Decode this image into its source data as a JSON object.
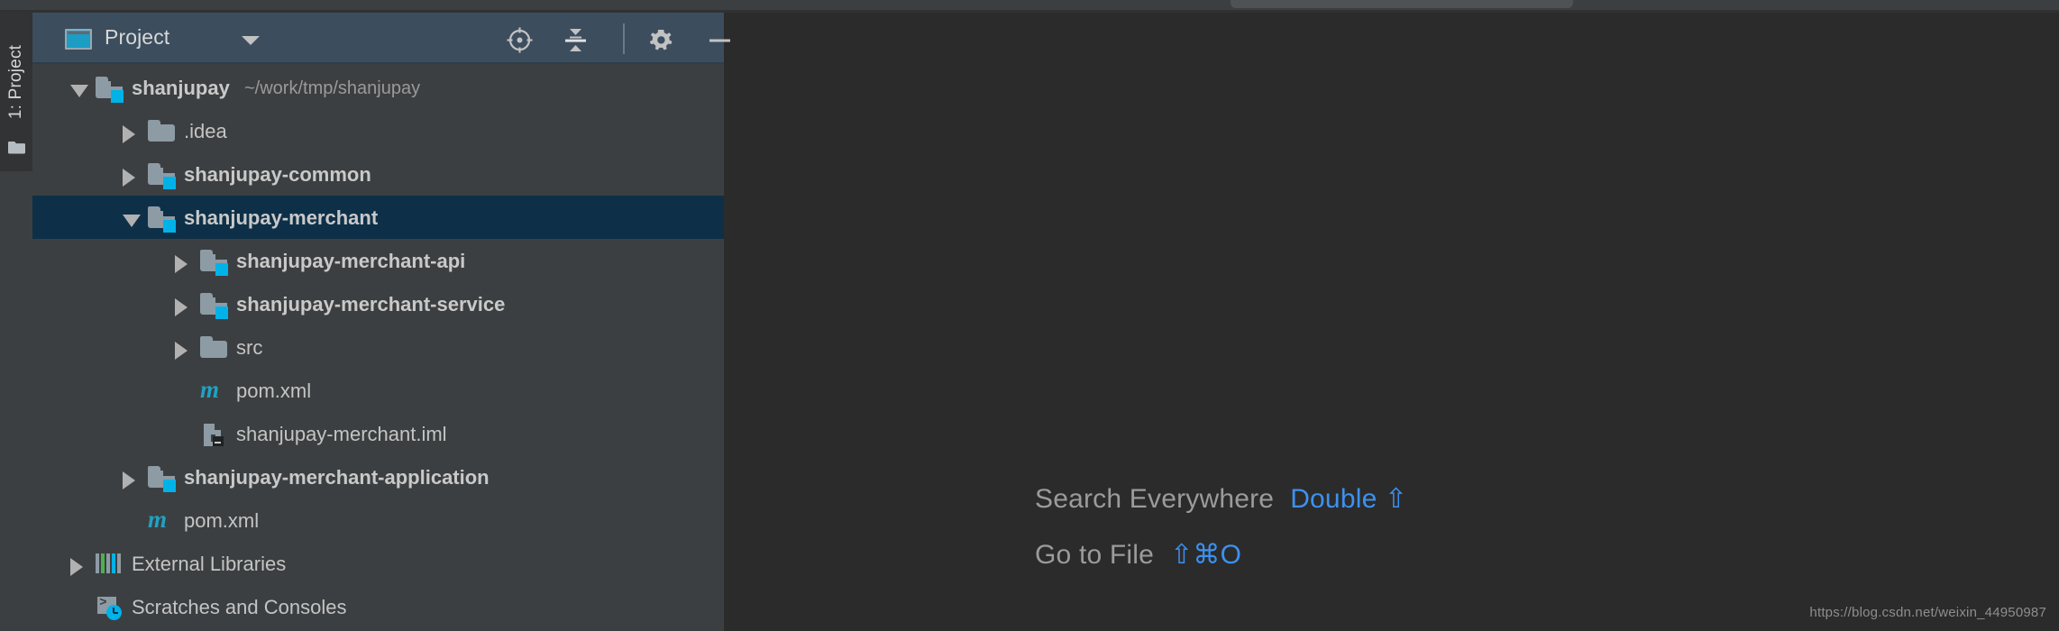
{
  "window": {
    "background_color": "#2b2b2b",
    "panel_color": "#3c3f41",
    "header_color": "#3c4d5e",
    "selection_color": "#0d3048",
    "accent_color": "#00b2e8",
    "link_color": "#3d91f0"
  },
  "tool_window_tab": {
    "label": "1: Project",
    "icon": "folder-icon"
  },
  "panel": {
    "title": "Project",
    "title_icon": "project-view-icon",
    "dropdown_icon": "chevron-down-icon",
    "buttons": [
      {
        "name": "locate-button",
        "icon": "crosshair-target-icon",
        "tooltip": "Select Opened File"
      },
      {
        "name": "collapse-all-button",
        "icon": "collapse-all-icon",
        "tooltip": "Collapse All"
      },
      {
        "name": "settings-button",
        "icon": "gear-icon",
        "tooltip": "Settings"
      },
      {
        "name": "hide-button",
        "icon": "minimize-icon",
        "tooltip": "Hide"
      }
    ]
  },
  "tree": {
    "rows": [
      {
        "label": "shanjupay",
        "path": "~/work/tmp/shanjupay",
        "icon": "module-folder-icon",
        "twisty": "open",
        "depth": 0,
        "bold": true,
        "selected": false
      },
      {
        "label": ".idea",
        "path": "",
        "icon": "folder-icon",
        "twisty": "closed",
        "depth": 1,
        "bold": false,
        "selected": false
      },
      {
        "label": "shanjupay-common",
        "path": "",
        "icon": "module-folder-icon",
        "twisty": "closed",
        "depth": 1,
        "bold": true,
        "selected": false
      },
      {
        "label": "shanjupay-merchant",
        "path": "",
        "icon": "module-folder-icon",
        "twisty": "open",
        "depth": 1,
        "bold": true,
        "selected": true
      },
      {
        "label": "shanjupay-merchant-api",
        "path": "",
        "icon": "module-folder-icon",
        "twisty": "closed",
        "depth": 2,
        "bold": true,
        "selected": false
      },
      {
        "label": "shanjupay-merchant-service",
        "path": "",
        "icon": "module-folder-icon",
        "twisty": "closed",
        "depth": 2,
        "bold": true,
        "selected": false
      },
      {
        "label": "src",
        "path": "",
        "icon": "folder-icon",
        "twisty": "closed",
        "depth": 2,
        "bold": false,
        "selected": false
      },
      {
        "label": "pom.xml",
        "path": "",
        "icon": "maven-icon",
        "twisty": "none",
        "depth": 2,
        "bold": false,
        "selected": false
      },
      {
        "label": "shanjupay-merchant.iml",
        "path": "",
        "icon": "iml-file-icon",
        "twisty": "none",
        "depth": 2,
        "bold": false,
        "selected": false
      },
      {
        "label": "shanjupay-merchant-application",
        "path": "",
        "icon": "module-folder-icon",
        "twisty": "closed",
        "depth": 1,
        "bold": true,
        "selected": false
      },
      {
        "label": "pom.xml",
        "path": "",
        "icon": "maven-icon",
        "twisty": "none",
        "depth": 1,
        "bold": false,
        "selected": false
      },
      {
        "label": "External Libraries",
        "path": "",
        "icon": "external-libraries-icon",
        "twisty": "closed",
        "depth": 0,
        "bold": false,
        "selected": false
      },
      {
        "label": "Scratches and Consoles",
        "path": "",
        "icon": "scratches-icon",
        "twisty": "none",
        "depth": 0,
        "bold": false,
        "selected": false
      }
    ]
  },
  "editor_hints": [
    {
      "action": "Search Everywhere",
      "shortcut": "Double ⇧"
    },
    {
      "action": "Go to File",
      "shortcut": "⇧⌘O"
    }
  ],
  "watermark": {
    "text": "https://blog.csdn.net/weixin_44950987"
  }
}
